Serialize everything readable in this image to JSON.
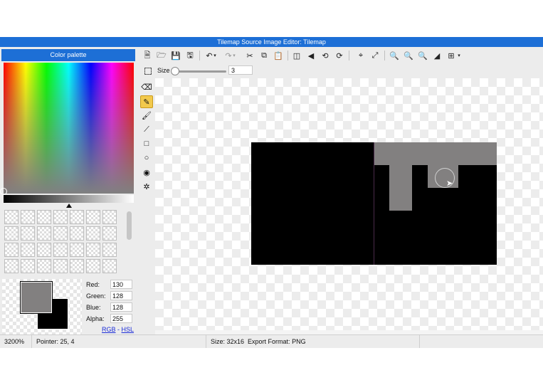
{
  "window": {
    "title": "Tilemap Source Image Editor: Tilemap",
    "title_bar_color": "#1d6fd6"
  },
  "color_palette": {
    "header": "Color palette",
    "primary_color": "#828080",
    "secondary_color": "#000000",
    "fields": [
      {
        "label": "Red:",
        "value": "130"
      },
      {
        "label": "Green:",
        "value": "128"
      },
      {
        "label": "Blue:",
        "value": "128"
      },
      {
        "label": "Alpha:",
        "value": "255"
      }
    ],
    "mode_rgb": "RGB",
    "mode_sep": " - ",
    "mode_hsl": "HSL"
  },
  "toolbar": {
    "icons": [
      "new-file-icon",
      "open-folder-icon",
      "save-icon",
      "save-as-icon",
      "undo-icon",
      "undo-dropdown-icon",
      "redo-icon",
      "redo-dropdown-icon",
      "cut-icon",
      "copy-icon",
      "paste-icon",
      "flip-horizontal-icon",
      "flip-vertical-icon",
      "rotate-left-icon",
      "rotate-right-icon",
      "crop-icon",
      "resize-icon",
      "zoom-in-icon",
      "zoom-out-icon",
      "zoom-reset-icon",
      "toggle-background-icon",
      "grid-icon",
      "grid-dropdown-icon"
    ]
  },
  "options": {
    "size_label": "Size",
    "size_value": "3",
    "size_slider_fraction": 0.03
  },
  "tools": {
    "items": [
      "eraser",
      "pencil",
      "brush",
      "line",
      "rectangle",
      "ellipse",
      "fill-bucket",
      "color-picker"
    ],
    "active": "pencil"
  },
  "canvas": {
    "image_color": "#000000",
    "draw_color": "#828080"
  },
  "status": {
    "zoom": "3200%",
    "pointer": "Pointer: 25, 4",
    "size": "Size: 32x16",
    "export_format": "Export Format: PNG"
  }
}
